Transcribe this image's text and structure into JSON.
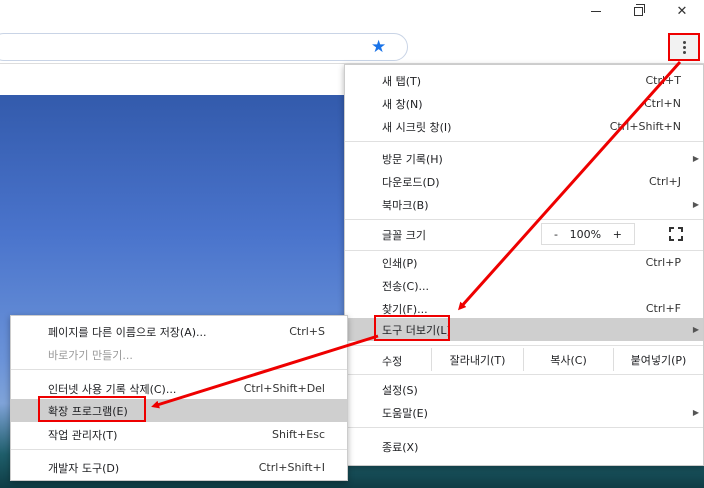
{
  "window": {
    "minimize_label": "—",
    "close_label": "✕"
  },
  "toolbar": {
    "star_icon": "star-icon"
  },
  "menu": {
    "items": [
      {
        "label": "새 탭(T)",
        "shortcut": "Ctrl+T"
      },
      {
        "label": "새 창(N)",
        "shortcut": "Ctrl+N"
      },
      {
        "label": "새 시크릿 창(I)",
        "shortcut": "Ctrl+Shift+N"
      },
      {
        "label": "방문 기록(H)",
        "shortcut": ""
      },
      {
        "label": "다운로드(D)",
        "shortcut": "Ctrl+J"
      },
      {
        "label": "북마크(B)",
        "shortcut": ""
      },
      {
        "label": "인쇄(P)",
        "shortcut": "Ctrl+P"
      },
      {
        "label": "전송(C)...",
        "shortcut": ""
      },
      {
        "label": "찾기(F)...",
        "shortcut": "Ctrl+F"
      },
      {
        "label": "도구 더보기(L)",
        "shortcut": ""
      },
      {
        "label": "설정(S)",
        "shortcut": ""
      },
      {
        "label": "도움말(E)",
        "shortcut": ""
      },
      {
        "label": "종료(X)",
        "shortcut": ""
      }
    ],
    "zoom": {
      "label": "글꼴 크기",
      "minus": "-",
      "value": "100%",
      "plus": "+"
    },
    "edit": {
      "label": "수정",
      "cut": "잘라내기(T)",
      "copy": "복사(C)",
      "paste": "붙여넣기(P)"
    }
  },
  "submenu": {
    "items": [
      {
        "label": "페이지를 다른 이름으로 저장(A)...",
        "shortcut": "Ctrl+S"
      },
      {
        "label": "바로가기 만들기...",
        "shortcut": ""
      },
      {
        "label": "인터넷 사용 기록 삭제(C)...",
        "shortcut": "Ctrl+Shift+Del"
      },
      {
        "label": "확장 프로그램(E)",
        "shortcut": ""
      },
      {
        "label": "작업 관리자(T)",
        "shortcut": "Shift+Esc"
      },
      {
        "label": "개발자 도구(D)",
        "shortcut": "Ctrl+Shift+I"
      }
    ]
  }
}
